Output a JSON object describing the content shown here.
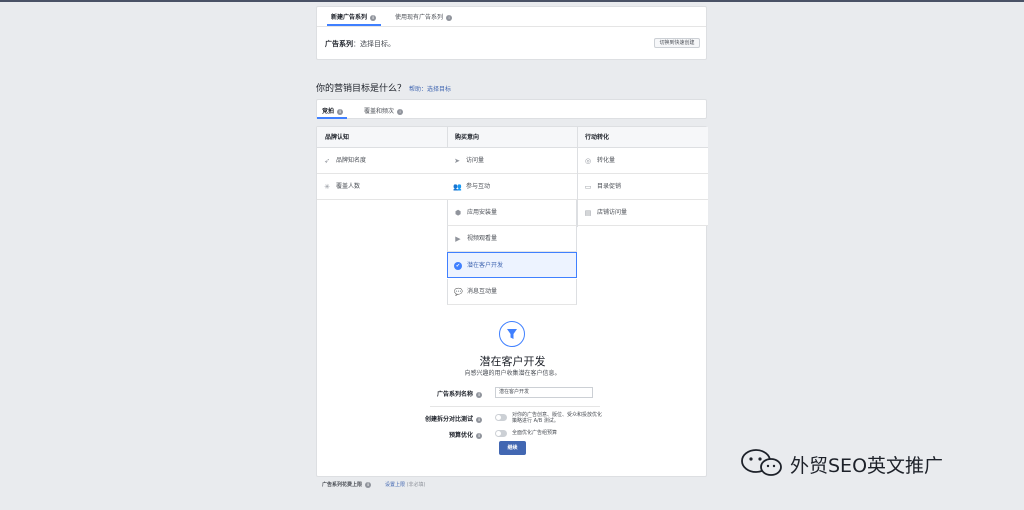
{
  "header": {
    "tab_new": "新建广告系列",
    "tab_existing": "使用现有广告系列",
    "campaign_label": "广告系列",
    "campaign_hint": "：选择目标。",
    "quick_create": "切换到快速创建"
  },
  "objective": {
    "question": "你的营销目标是什么？",
    "help_link": "帮助：选择目标"
  },
  "buy_tabs": {
    "auction": "竞拍",
    "reach_frequency": "覆盖和频次"
  },
  "columns": [
    {
      "heading": "品牌认知",
      "items": [
        {
          "label": "品牌知名度",
          "icon": "megaphone-icon"
        },
        {
          "label": "覆盖人数",
          "icon": "burst-icon"
        }
      ]
    },
    {
      "heading": "购买意向",
      "items": [
        {
          "label": "访问量",
          "icon": "cursor-icon"
        },
        {
          "label": "参与互动",
          "icon": "people-icon"
        },
        {
          "label": "应用安装量",
          "icon": "app-box-icon"
        },
        {
          "label": "视频观看量",
          "icon": "video-camera-icon"
        },
        {
          "label": "潜在客户开发",
          "icon": "check-circle-icon",
          "selected": true
        },
        {
          "label": "消息互动量",
          "icon": "chat-bubbles-icon"
        }
      ]
    },
    {
      "heading": "行动转化",
      "items": [
        {
          "label": "转化量",
          "icon": "globe-icon"
        },
        {
          "label": "目录促销",
          "icon": "cart-icon"
        },
        {
          "label": "店铺访问量",
          "icon": "store-icon"
        }
      ]
    }
  ],
  "detail": {
    "title": "潜在客户开发",
    "subtitle": "向感兴趣的用户收集潜在客户信息。",
    "name_label": "广告系列名称",
    "name_value": "潜在客户开发",
    "split_label": "创建拆分对比测试",
    "split_note_1": "对你的广告创意、版位、受众和投放优化",
    "split_note_2": "策略进行 A/B 测试。",
    "budget_label": "预算优化",
    "budget_note": "全面优化广告组预算",
    "continue": "继续"
  },
  "footer": {
    "limit_label": "广告系列花费上限",
    "limit_link": "设置上限",
    "limit_optional": "(非必填)"
  },
  "watermark": {
    "text": "外贸SEO英文推广"
  },
  "colors": {
    "accent": "#4080ff",
    "button": "#4267b2",
    "background": "#e9ebee"
  }
}
